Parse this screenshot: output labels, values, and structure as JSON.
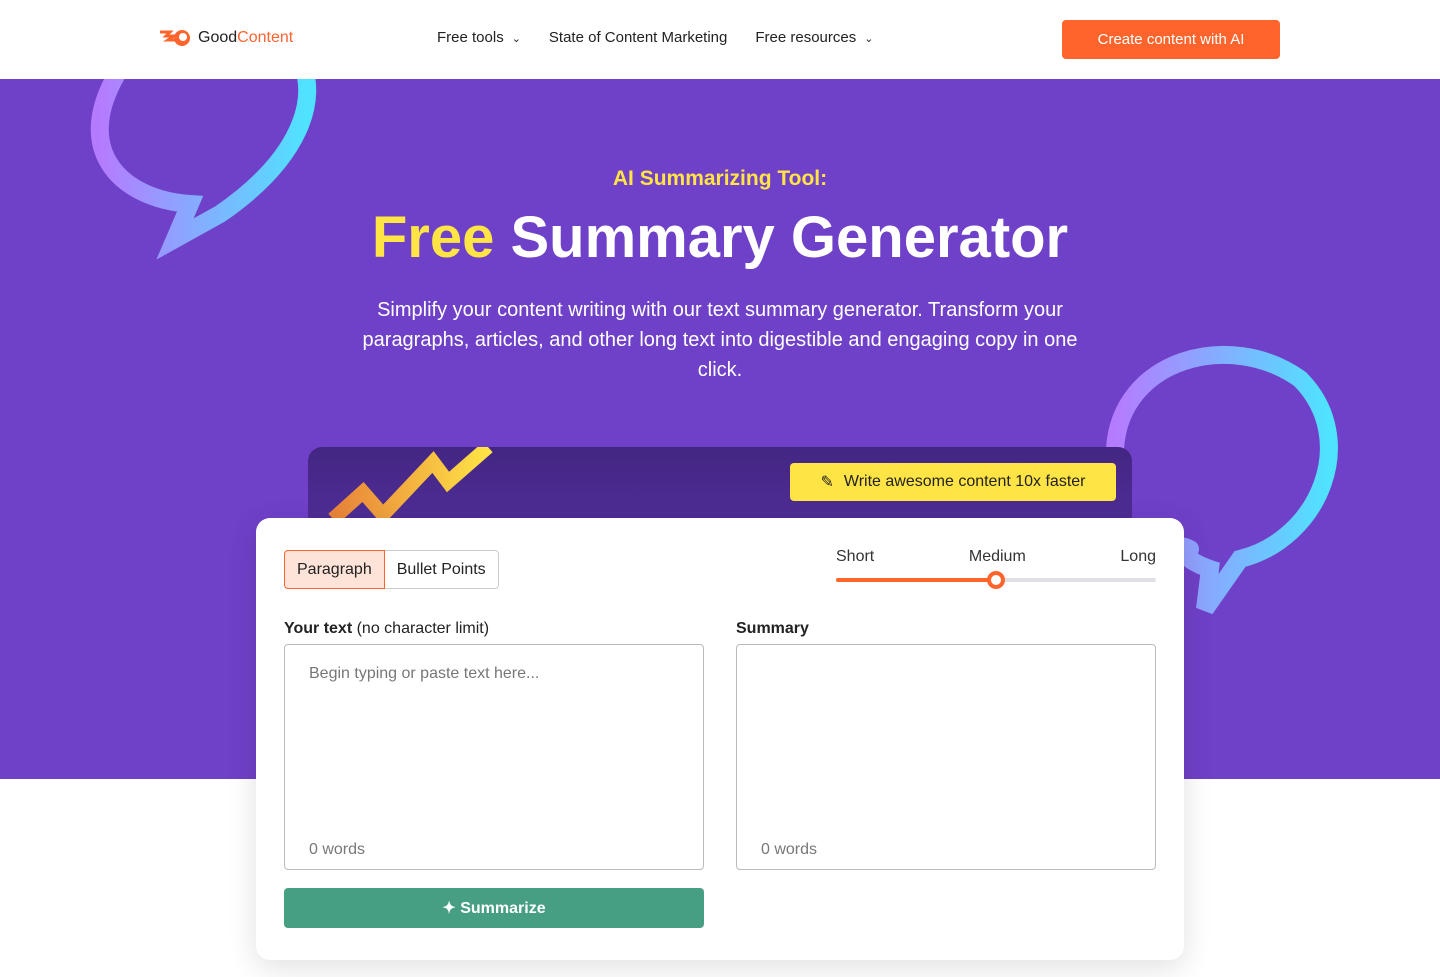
{
  "nav": {
    "logo_a": "Good",
    "logo_b": "Content",
    "links": [
      "Free tools",
      "State of Content Marketing",
      "Free resources"
    ],
    "cta": "Create content with AI"
  },
  "hero": {
    "eyebrow": "AI Summarizing Tool:",
    "title_free": "Free",
    "title_rest": " Summary Generator",
    "description": "Simplify your content writing with our text summary generator. Transform your paragraphs, articles, and other long text into digestible and engaging copy in one click.",
    "banner_button": "Write awesome content 10x faster"
  },
  "tool": {
    "tabs": [
      "Paragraph",
      "Bullet Points"
    ],
    "active_tab": "Paragraph",
    "length_options": [
      "Short",
      "Medium",
      "Long"
    ],
    "length_selected": "Medium",
    "length_value": 0.5,
    "input_label": "Your text",
    "input_hint": " (no character limit)",
    "input_placeholder": "Begin typing or paste text here...",
    "input_words": "0 words",
    "summary_label": "Summary",
    "summary_words": "0 words",
    "summarize_button": "Summarize"
  },
  "colors": {
    "brand": "#ff642d",
    "hero_bg": "#6f40c8",
    "accent_yellow": "#ffe445",
    "summarize": "#469f83"
  }
}
